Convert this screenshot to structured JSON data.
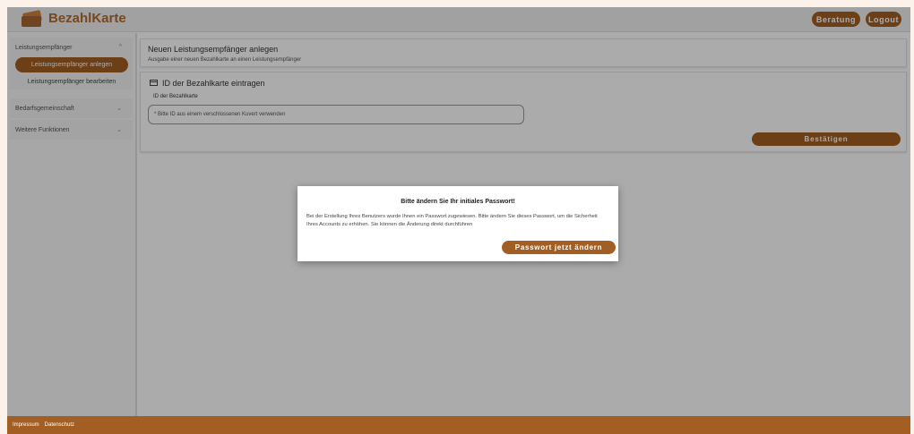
{
  "app": {
    "logo_text": "BezahlKarte"
  },
  "header": {
    "beratung_label": "Beratung",
    "logout_label": "Logout"
  },
  "sidebar": {
    "group_leistung": "Leistungsempfänger",
    "sub_anlegen": "Leistungsempfänger anlegen",
    "sub_bearbeiten": "Leistungsempfänger bearbeiten",
    "group_bedarf": "Bedarfsgemeinschaft",
    "group_weitere": "Weitere Funktionen"
  },
  "main": {
    "title": "Neuen Leistungsempfänger anlegen",
    "subtitle": "Ausgabe einer neuen Bezahlkarte an einen Leistungsempfänger",
    "section_title": "ID der Bezahlkarte eintragen",
    "field_label": "ID der Bezahlkarte",
    "field_placeholder": "* Bitte ID aus einem verschlossenen Kuvert verwenden",
    "confirm_label": "Bestätigen"
  },
  "dialog": {
    "title": "Bitte ändern Sie Ihr initiales Passwort!",
    "body": "Bei der Erstellung Ihres Benutzers wurde Ihnen ein Passwort zugewiesen. Bitte ändern Sie dieses Passwort, um die Sicherheit Ihres Accounts zu erhöhen. Sie können die Änderung direkt durchführen",
    "button_label": "Passwort jetzt ändern"
  },
  "footer": {
    "impressum": "Impressum",
    "datenschutz": "Datenschutz"
  },
  "colors": {
    "brand": "#a35f23",
    "page_bg": "#fcf2e9"
  }
}
